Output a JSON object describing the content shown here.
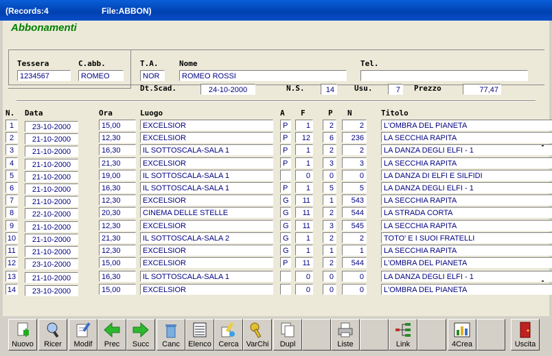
{
  "window": {
    "records": "(Records:4",
    "file": "File:ABBON)"
  },
  "heading": "Abbonamenti",
  "labels": {
    "tessera": "Tessera",
    "cabb": "C.abb.",
    "ta": "T.A.",
    "nome": "Nome",
    "tel": "Tel.",
    "dtscad": "Dt.Scad.",
    "ns": "N.S.",
    "usu": "Usu.",
    "prezzo": "Prezzo"
  },
  "fields": {
    "tessera": "1234567",
    "cabb": "ROMEO",
    "ta": "NOR",
    "nome": "ROMEO ROSSI",
    "tel": "",
    "dtscad": "24-10-2000",
    "ns": "14",
    "usu": "7",
    "prezzo": "77,47"
  },
  "columns": {
    "n": "N.",
    "data": "Data",
    "ora": "Ora",
    "luogo": "Luogo",
    "a": "A",
    "f": "F",
    "p": "P",
    "nn": "N",
    "titolo": "Titolo"
  },
  "rows": [
    {
      "n": "1",
      "data": "23-10-2000",
      "ora": "15,00",
      "luogo": "EXCELSIOR",
      "a": "P",
      "f": "1",
      "p": "2",
      "nn": "2",
      "titolo": "L'OMBRA DEL PIANETA"
    },
    {
      "n": "2",
      "data": "21-10-2000",
      "ora": "12,30",
      "luogo": "EXCELSIOR",
      "a": "P",
      "f": "12",
      "p": "6",
      "nn": "236",
      "titolo": "LA SECCHIA RAPITA"
    },
    {
      "n": "3",
      "data": "21-10-2000",
      "ora": "16,30",
      "luogo": "IL SOTTOSCALA-SALA 1",
      "a": "P",
      "f": "1",
      "p": "2",
      "nn": "2",
      "titolo": "LA DANZA DEGLI ELFI - 1"
    },
    {
      "n": "4",
      "data": "21-10-2000",
      "ora": "21,30",
      "luogo": "EXCELSIOR",
      "a": "P",
      "f": "1",
      "p": "3",
      "nn": "3",
      "titolo": "LA SECCHIA RAPITA"
    },
    {
      "n": "5",
      "data": "21-10-2000",
      "ora": "19,00",
      "luogo": "IL SOTTOSCALA-SALA 1",
      "a": "",
      "f": "0",
      "p": "0",
      "nn": "0",
      "titolo": "LA DANZA DI ELFI E SILFIDI"
    },
    {
      "n": "6",
      "data": "21-10-2000",
      "ora": "16,30",
      "luogo": "IL SOTTOSCALA-SALA 1",
      "a": "P",
      "f": "1",
      "p": "5",
      "nn": "5",
      "titolo": "LA DANZA DEGLI ELFI - 1"
    },
    {
      "n": "7",
      "data": "21-10-2000",
      "ora": "12,30",
      "luogo": "EXCELSIOR",
      "a": "G",
      "f": "11",
      "p": "1",
      "nn": "543",
      "titolo": "LA SECCHIA RAPITA"
    },
    {
      "n": "8",
      "data": "22-10-2000",
      "ora": "20,30",
      "luogo": "CINEMA DELLE STELLE",
      "a": "G",
      "f": "11",
      "p": "2",
      "nn": "544",
      "titolo": "LA STRADA CORTA"
    },
    {
      "n": "9",
      "data": "21-10-2000",
      "ora": "12,30",
      "luogo": "EXCELSIOR",
      "a": "G",
      "f": "11",
      "p": "3",
      "nn": "545",
      "titolo": "LA SECCHIA RAPITA"
    },
    {
      "n": "10",
      "data": "21-10-2000",
      "ora": "21,30",
      "luogo": "IL SOTTOSCALA-SALA 2",
      "a": "G",
      "f": "1",
      "p": "2",
      "nn": "2",
      "titolo": "TOTO' E I SUOI FRATELLI"
    },
    {
      "n": "11",
      "data": "21-10-2000",
      "ora": "12,30",
      "luogo": "EXCELSIOR",
      "a": "G",
      "f": "1",
      "p": "1",
      "nn": "1",
      "titolo": "LA SECCHIA RAPITA"
    },
    {
      "n": "12",
      "data": "23-10-2000",
      "ora": "15,00",
      "luogo": "EXCELSIOR",
      "a": "P",
      "f": "11",
      "p": "2",
      "nn": "544",
      "titolo": "L'OMBRA DEL PIANETA"
    },
    {
      "n": "13",
      "data": "21-10-2000",
      "ora": "16,30",
      "luogo": "IL SOTTOSCALA-SALA 1",
      "a": "",
      "f": "0",
      "p": "0",
      "nn": "0",
      "titolo": "LA DANZA DEGLI ELFI - 1"
    },
    {
      "n": "14",
      "data": "23-10-2000",
      "ora": "15,00",
      "luogo": "EXCELSIOR",
      "a": "",
      "f": "0",
      "p": "0",
      "nn": "0",
      "titolo": "L'OMBRA DEL PIANETA"
    }
  ],
  "toolbar": [
    {
      "name": "nuovo",
      "label": "Nuovo",
      "icon": "new-icon"
    },
    {
      "name": "ricer",
      "label": "Ricer",
      "icon": "search-icon"
    },
    {
      "name": "modif",
      "label": "Modif",
      "icon": "edit-icon"
    },
    {
      "name": "prec",
      "label": "Prec",
      "icon": "arrow-left-icon"
    },
    {
      "name": "succ",
      "label": "Succ",
      "icon": "arrow-right-icon"
    },
    {
      "name": "canc",
      "label": "Canc",
      "icon": "trash-icon"
    },
    {
      "name": "elenco",
      "label": "Elenco",
      "icon": "list-icon"
    },
    {
      "name": "cerca",
      "label": "Cerca",
      "icon": "find-icon"
    },
    {
      "name": "varchi",
      "label": "VarChi",
      "icon": "key-icon"
    },
    {
      "name": "dupl",
      "label": "Dupl",
      "icon": "duplicate-icon"
    },
    {
      "name": "blank1",
      "label": "",
      "icon": ""
    },
    {
      "name": "liste",
      "label": "Liste",
      "icon": "printer-icon"
    },
    {
      "name": "blank2",
      "label": "",
      "icon": ""
    },
    {
      "name": "link",
      "label": "Link",
      "icon": "tree-icon"
    },
    {
      "name": "blank3",
      "label": "",
      "icon": ""
    },
    {
      "name": "4crea",
      "label": "4Crea",
      "icon": "chart-icon"
    },
    {
      "name": "blank4",
      "label": "",
      "icon": ""
    },
    {
      "name": "uscita",
      "label": "Uscita",
      "icon": "exit-door-icon"
    }
  ]
}
